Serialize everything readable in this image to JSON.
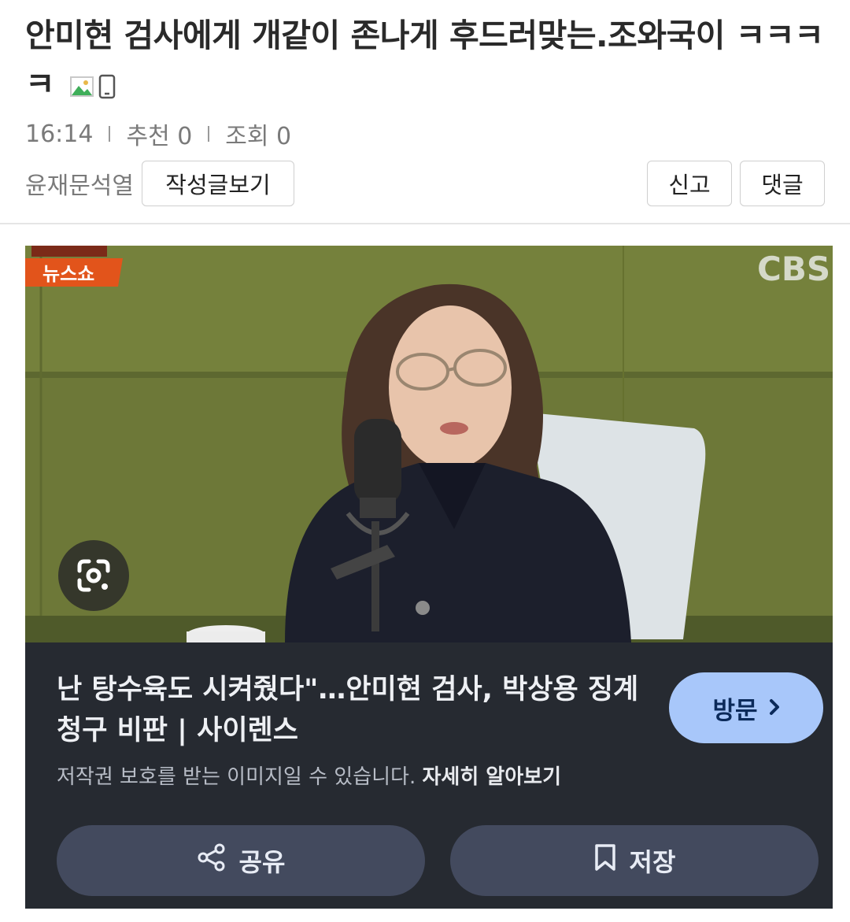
{
  "post": {
    "title": "안미현 검사에게 개같이 존나게 후드러맞는.조와국이 ㅋㅋㅋㅋ",
    "time": "16:14",
    "recommend": "추천 0",
    "views": "조회 0",
    "author": "윤재문석열",
    "view_posts_label": "작성글보기",
    "report_label": "신고",
    "comment_label": "댓글",
    "icons": [
      "image-icon",
      "mobile-icon"
    ]
  },
  "embed": {
    "photo_overlay_text": "뉴스쇼",
    "photo_watermark": "CBS",
    "headline": "난 탕수육도 시켜줬다\"…안미현 검사, 박상용 징계 청구 비판 | 사이렌스",
    "visit_label": "방문",
    "copyright_text": "저작권 보호를 받는 이미지일 수 있습니다.",
    "learn_more_label": "자세히 알아보기",
    "share_label": "공유",
    "save_label": "저장",
    "colors": {
      "panel_bg": "#262a31",
      "visit_button": "#a8c7fa",
      "action_button": "#434a5e"
    }
  }
}
